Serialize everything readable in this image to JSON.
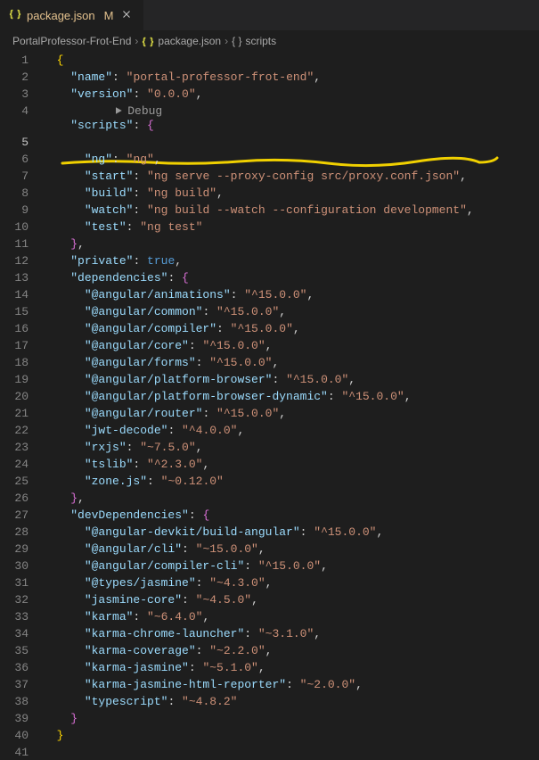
{
  "tab": {
    "label": "package.json",
    "modified": "M"
  },
  "breadcrumb": {
    "folder": "PortalProfessor-Frot-End",
    "file": "package.json",
    "section": "scripts",
    "braces": "{ }"
  },
  "debug": {
    "label": "Debug"
  },
  "lines": [
    {
      "n": "1",
      "i": 1,
      "t": "{",
      "ob": true
    },
    {
      "n": "2",
      "i": 2,
      "k": "name",
      "v": "portal-professor-frot-end",
      "c": true
    },
    {
      "n": "3",
      "i": 2,
      "k": "version",
      "v": "0.0.0",
      "c": true
    },
    {
      "n": "4",
      "i": 2,
      "k": "scripts",
      "ob": "{"
    },
    {
      "n": "5",
      "i": 3,
      "blank": true
    },
    {
      "n": "6",
      "i": 3,
      "k": "ng",
      "v": "ng",
      "c": true
    },
    {
      "n": "7",
      "i": 3,
      "k": "start",
      "v": "ng serve --proxy-config src/proxy.conf.json",
      "c": true
    },
    {
      "n": "8",
      "i": 3,
      "k": "build",
      "v": "ng build",
      "c": true
    },
    {
      "n": "9",
      "i": 3,
      "k": "watch",
      "v": "ng build --watch --configuration development",
      "c": true
    },
    {
      "n": "10",
      "i": 3,
      "k": "test",
      "v": "ng test"
    },
    {
      "n": "11",
      "i": 2,
      "cb": "}",
      "c": true,
      "ib": true
    },
    {
      "n": "12",
      "i": 2,
      "k": "private",
      "bv": "true",
      "c": true
    },
    {
      "n": "13",
      "i": 2,
      "k": "dependencies",
      "ob": "{"
    },
    {
      "n": "14",
      "i": 3,
      "k": "@angular/animations",
      "v": "^15.0.0",
      "c": true
    },
    {
      "n": "15",
      "i": 3,
      "k": "@angular/common",
      "v": "^15.0.0",
      "c": true
    },
    {
      "n": "16",
      "i": 3,
      "k": "@angular/compiler",
      "v": "^15.0.0",
      "c": true
    },
    {
      "n": "17",
      "i": 3,
      "k": "@angular/core",
      "v": "^15.0.0",
      "c": true
    },
    {
      "n": "18",
      "i": 3,
      "k": "@angular/forms",
      "v": "^15.0.0",
      "c": true
    },
    {
      "n": "19",
      "i": 3,
      "k": "@angular/platform-browser",
      "v": "^15.0.0",
      "c": true
    },
    {
      "n": "20",
      "i": 3,
      "k": "@angular/platform-browser-dynamic",
      "v": "^15.0.0",
      "c": true
    },
    {
      "n": "21",
      "i": 3,
      "k": "@angular/router",
      "v": "^15.0.0",
      "c": true
    },
    {
      "n": "22",
      "i": 3,
      "k": "jwt-decode",
      "v": "^4.0.0",
      "c": true
    },
    {
      "n": "23",
      "i": 3,
      "k": "rxjs",
      "v": "~7.5.0",
      "c": true
    },
    {
      "n": "24",
      "i": 3,
      "k": "tslib",
      "v": "^2.3.0",
      "c": true
    },
    {
      "n": "25",
      "i": 3,
      "k": "zone.js",
      "v": "~0.12.0"
    },
    {
      "n": "26",
      "i": 2,
      "cb": "}",
      "c": true,
      "ib": true
    },
    {
      "n": "27",
      "i": 2,
      "k": "devDependencies",
      "ob": "{"
    },
    {
      "n": "28",
      "i": 3,
      "k": "@angular-devkit/build-angular",
      "v": "^15.0.0",
      "c": true
    },
    {
      "n": "29",
      "i": 3,
      "k": "@angular/cli",
      "v": "~15.0.0",
      "c": true
    },
    {
      "n": "30",
      "i": 3,
      "k": "@angular/compiler-cli",
      "v": "^15.0.0",
      "c": true
    },
    {
      "n": "31",
      "i": 3,
      "k": "@types/jasmine",
      "v": "~4.3.0",
      "c": true
    },
    {
      "n": "32",
      "i": 3,
      "k": "jasmine-core",
      "v": "~4.5.0",
      "c": true
    },
    {
      "n": "33",
      "i": 3,
      "k": "karma",
      "v": "~6.4.0",
      "c": true
    },
    {
      "n": "34",
      "i": 3,
      "k": "karma-chrome-launcher",
      "v": "~3.1.0",
      "c": true
    },
    {
      "n": "35",
      "i": 3,
      "k": "karma-coverage",
      "v": "~2.2.0",
      "c": true
    },
    {
      "n": "36",
      "i": 3,
      "k": "karma-jasmine",
      "v": "~5.1.0",
      "c": true
    },
    {
      "n": "37",
      "i": 3,
      "k": "karma-jasmine-html-reporter",
      "v": "~2.0.0",
      "c": true
    },
    {
      "n": "38",
      "i": 3,
      "k": "typescript",
      "v": "~4.8.2"
    },
    {
      "n": "39",
      "i": 2,
      "cb": "}",
      "ib": true
    },
    {
      "n": "40",
      "i": 1,
      "cb": "}",
      "ob_c": true
    },
    {
      "n": "41",
      "i": 0,
      "blank": true
    }
  ]
}
